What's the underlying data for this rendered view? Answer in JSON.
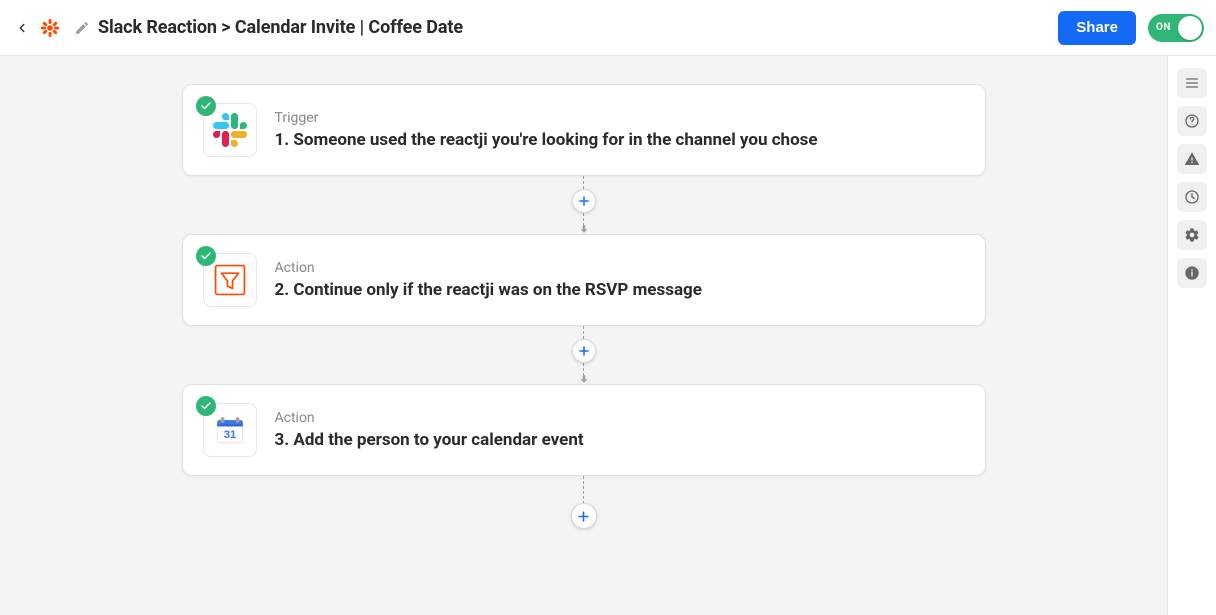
{
  "header": {
    "title": "Slack Reaction > Calendar Invite | Coffee Date",
    "share_label": "Share",
    "toggle_label": "ON",
    "toggle_state": true
  },
  "steps": [
    {
      "kicker": "Trigger",
      "title": "1. Someone used the reactji you're looking for in the channel you chose",
      "icon": "slack-icon",
      "checked": true
    },
    {
      "kicker": "Action",
      "title": "2. Continue only if the reactji was on the RSVP message",
      "icon": "filter-icon",
      "checked": true
    },
    {
      "kicker": "Action",
      "title": "3. Add the person to your calendar event",
      "icon": "google-calendar-icon",
      "checked": true
    }
  ],
  "rail_icons": [
    "list-icon",
    "help-icon",
    "warning-icon",
    "history-icon",
    "settings-icon",
    "info-icon"
  ]
}
